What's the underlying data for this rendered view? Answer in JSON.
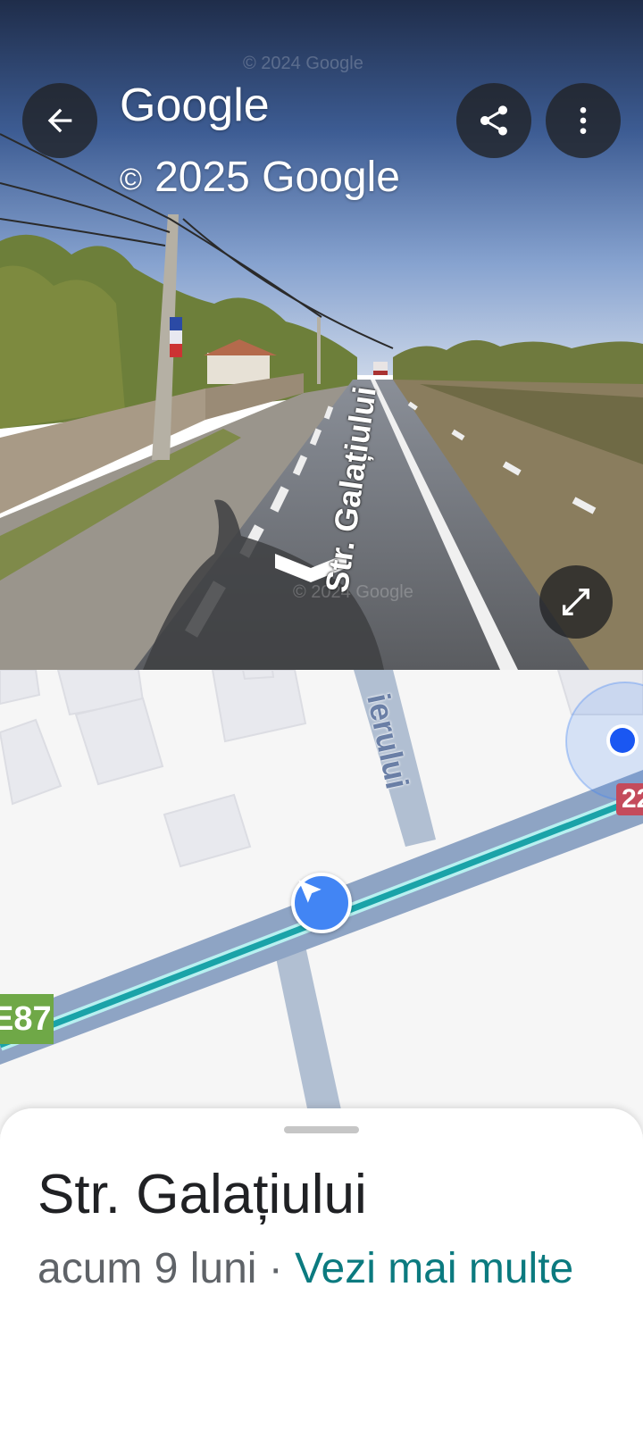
{
  "pano": {
    "title": "Google",
    "copyright": "2025 Google",
    "copyright_symbol": "©",
    "watermark_top": "© 2024 Google",
    "watermark_bottom": "© 2024 Google",
    "road_label": "Str. Galațiului",
    "icons": {
      "back": "arrow-left-icon",
      "share": "share-icon",
      "more": "more-vert-icon",
      "expand": "expand-icon",
      "nav_arrow": "chevron-down-icon"
    }
  },
  "map": {
    "street_partial": "ierului",
    "route_shield": "E87",
    "route_shield_right": "22",
    "colors": {
      "road": "#8ea4c4",
      "route_line": "#1aa3a8",
      "location_dot": "#1a57f2",
      "marker": "#4285f4"
    }
  },
  "sheet": {
    "title": "Str. Galațiului",
    "time": "acum 9 luni",
    "separator": " · ",
    "link": "Vezi mai multe"
  }
}
